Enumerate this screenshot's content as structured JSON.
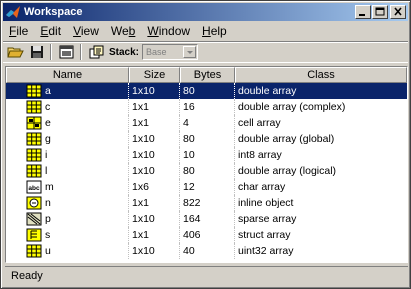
{
  "window": {
    "title": "Workspace"
  },
  "menu": {
    "items": [
      {
        "label": "File",
        "mnemonic": "F",
        "rest": "ile"
      },
      {
        "label": "Edit",
        "mnemonic": "E",
        "rest": "dit"
      },
      {
        "label": "View",
        "mnemonic": "V",
        "rest": "iew"
      },
      {
        "label": "Web",
        "prefix": "We",
        "mnemonic": "b",
        "rest": ""
      },
      {
        "label": "Window",
        "mnemonic": "W",
        "rest": "indow"
      },
      {
        "label": "Help",
        "mnemonic": "H",
        "rest": "elp"
      }
    ]
  },
  "toolbar": {
    "stack_label": "Stack:",
    "stack_value": "Base"
  },
  "table": {
    "headers": {
      "name": "Name",
      "size": "Size",
      "bytes": "Bytes",
      "class": "Class"
    },
    "selected_row": 0,
    "rows": [
      {
        "name": "a",
        "size": "1x10",
        "bytes": "80",
        "class": "double array",
        "icon": "matrix-icon"
      },
      {
        "name": "c",
        "size": "1x1",
        "bytes": "16",
        "class": "double array (complex)",
        "icon": "matrix-icon"
      },
      {
        "name": "e",
        "size": "1x1",
        "bytes": "4",
        "class": "cell array",
        "icon": "cell-array-icon"
      },
      {
        "name": "g",
        "size": "1x10",
        "bytes": "80",
        "class": "double array (global)",
        "icon": "matrix-icon"
      },
      {
        "name": "i",
        "size": "1x10",
        "bytes": "10",
        "class": "int8 array",
        "icon": "matrix-icon"
      },
      {
        "name": "l",
        "size": "1x10",
        "bytes": "80",
        "class": "double array (logical)",
        "icon": "matrix-icon"
      },
      {
        "name": "m",
        "size": "1x6",
        "bytes": "12",
        "class": "char array",
        "icon": "char-array-icon",
        "icon_text": "abc"
      },
      {
        "name": "n",
        "size": "1x1",
        "bytes": "822",
        "class": "inline object",
        "icon": "object-icon"
      },
      {
        "name": "p",
        "size": "1x10",
        "bytes": "164",
        "class": "sparse array",
        "icon": "sparse-array-icon"
      },
      {
        "name": "s",
        "size": "1x1",
        "bytes": "406",
        "class": "struct array",
        "icon": "struct-array-icon"
      },
      {
        "name": "u",
        "size": "1x10",
        "bytes": "40",
        "class": "uint32 array",
        "icon": "matrix-icon"
      }
    ]
  },
  "status": {
    "text": "Ready"
  },
  "colors": {
    "title_start": "#0a246a",
    "title_end": "#a6caf0",
    "selection": "#0a246a",
    "face": "#d4d0c8",
    "icon_yellow": "#ffff00"
  }
}
